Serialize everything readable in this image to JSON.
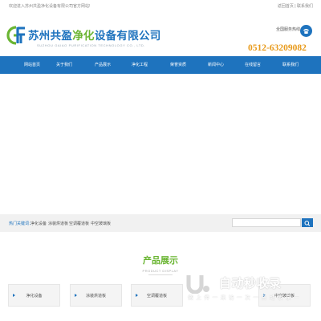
{
  "topbar": {
    "welcome": "欢迎进入苏州共盈净化设备有限公司官方网站!",
    "home_link": "返回首页",
    "separator": " | ",
    "contact_link": "联系我们"
  },
  "header": {
    "company_name_part1": "苏州共盈",
    "company_name_part2": "净化",
    "company_name_part3": "设备有限公司",
    "company_name_en": "SUZHOU GAIAO PURIFICATION TECHNOLOGY CO., LTD.",
    "hotline_label": "全国服务热线",
    "phone": "0512-63209082",
    "logo_icon": "gy-logo-icon",
    "phone_icon": "phone-icon"
  },
  "nav": {
    "items": [
      {
        "label": "网站首页"
      },
      {
        "label": "关于我们"
      },
      {
        "label": "产品展示"
      },
      {
        "label": "净化工程"
      },
      {
        "label": "荣誉资质"
      },
      {
        "label": "新闻中心"
      },
      {
        "label": "在线留言"
      },
      {
        "label": "联系我们"
      }
    ]
  },
  "keywords": {
    "label": "热门关键词：",
    "items": [
      "净化设备",
      "涂装烘道板",
      "空调覆道板",
      "中空玻璃板"
    ]
  },
  "search": {
    "placeholder": "",
    "value": ""
  },
  "products": {
    "title": "产品展示",
    "subtitle": "PRODUCT DISPLAY",
    "categories": [
      {
        "label": "净化设备"
      },
      {
        "label": "涂装烘道板"
      },
      {
        "label": "空调覆道板"
      },
      {
        "label": "中空玻璃板"
      }
    ]
  },
  "watermark": {
    "text": "自动秒收录",
    "subtext": "做 上 传 一 来 访 一 次 一 自 动 收 录 一"
  },
  "colors": {
    "brand_blue": "#1e73be",
    "brand_green": "#6ab532",
    "phone_orange": "#e89a1b"
  }
}
